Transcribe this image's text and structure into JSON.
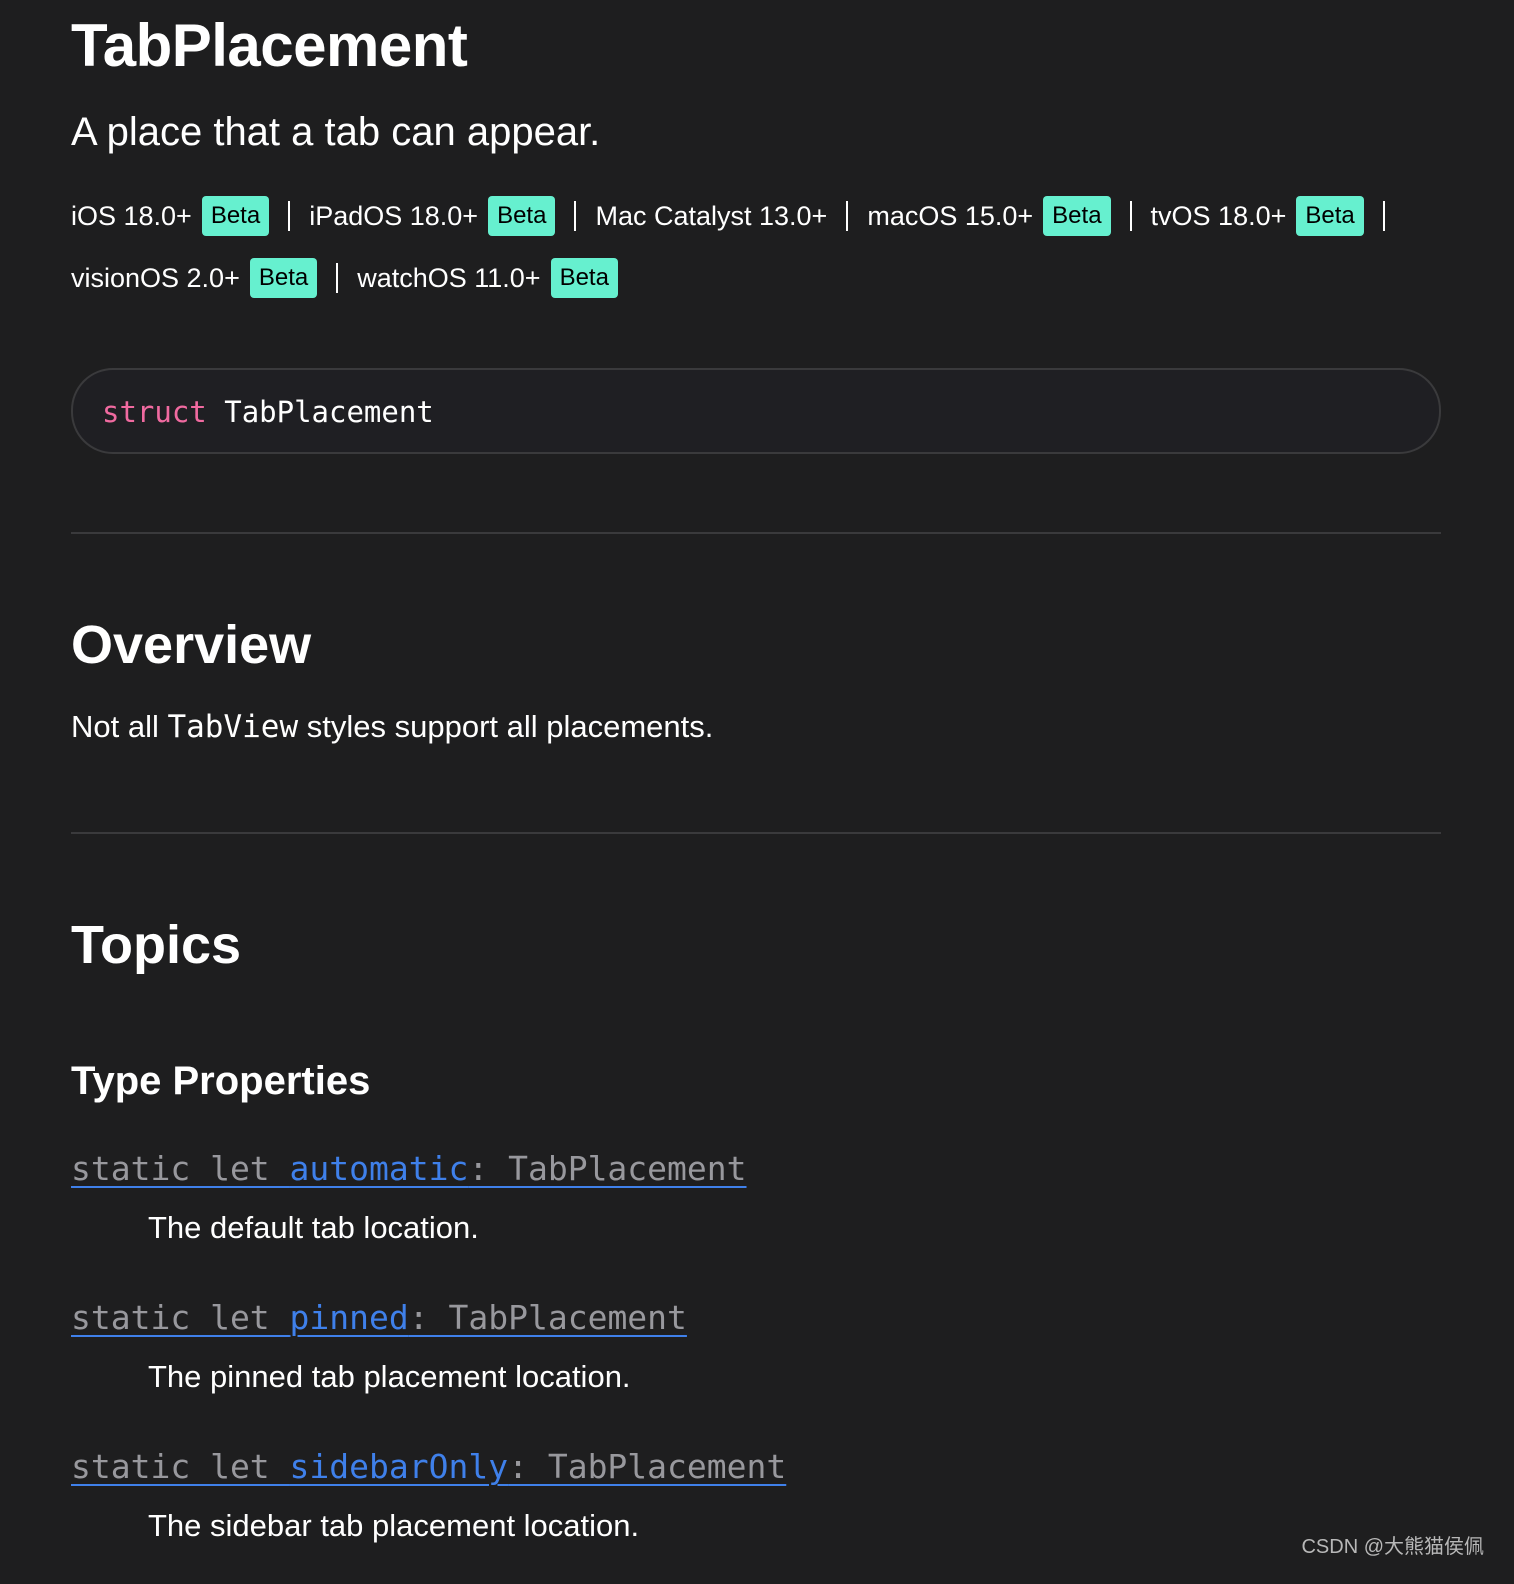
{
  "header": {
    "title": "TabPlacement",
    "subtitle": "A place that a tab can appear."
  },
  "platforms": [
    {
      "name": "iOS 18.0+",
      "badge": "Beta"
    },
    {
      "name": "iPadOS 18.0+",
      "badge": "Beta"
    },
    {
      "name": "Mac Catalyst 13.0+",
      "badge": ""
    },
    {
      "name": "macOS 15.0+",
      "badge": "Beta"
    },
    {
      "name": "tvOS 18.0+",
      "badge": "Beta"
    },
    {
      "name": "visionOS 2.0+",
      "badge": "Beta"
    },
    {
      "name": "watchOS 11.0+",
      "badge": "Beta"
    }
  ],
  "declaration": {
    "keyword": "struct",
    "name": "TabPlacement"
  },
  "overview": {
    "heading": "Overview",
    "text_before": "Not all ",
    "code": "TabView",
    "text_after": " styles support all placements."
  },
  "topics": {
    "heading": "Topics",
    "section_title": "Type Properties",
    "items": [
      {
        "prefix": "static let ",
        "name": "automatic",
        "suffix": ": TabPlacement",
        "description": "The default tab location."
      },
      {
        "prefix": "static let ",
        "name": "pinned",
        "suffix": ": TabPlacement",
        "description": "The pinned tab placement location."
      },
      {
        "prefix": "static let ",
        "name": "sidebarOnly",
        "suffix": ": TabPlacement",
        "description": "The sidebar tab placement location."
      }
    ]
  },
  "watermark": "CSDN @大熊猫侯佩",
  "colors": {
    "background": "#1e1e1f",
    "badge": "#66f0cf",
    "keyword": "#f06aa0",
    "link": "#3f80ea"
  }
}
